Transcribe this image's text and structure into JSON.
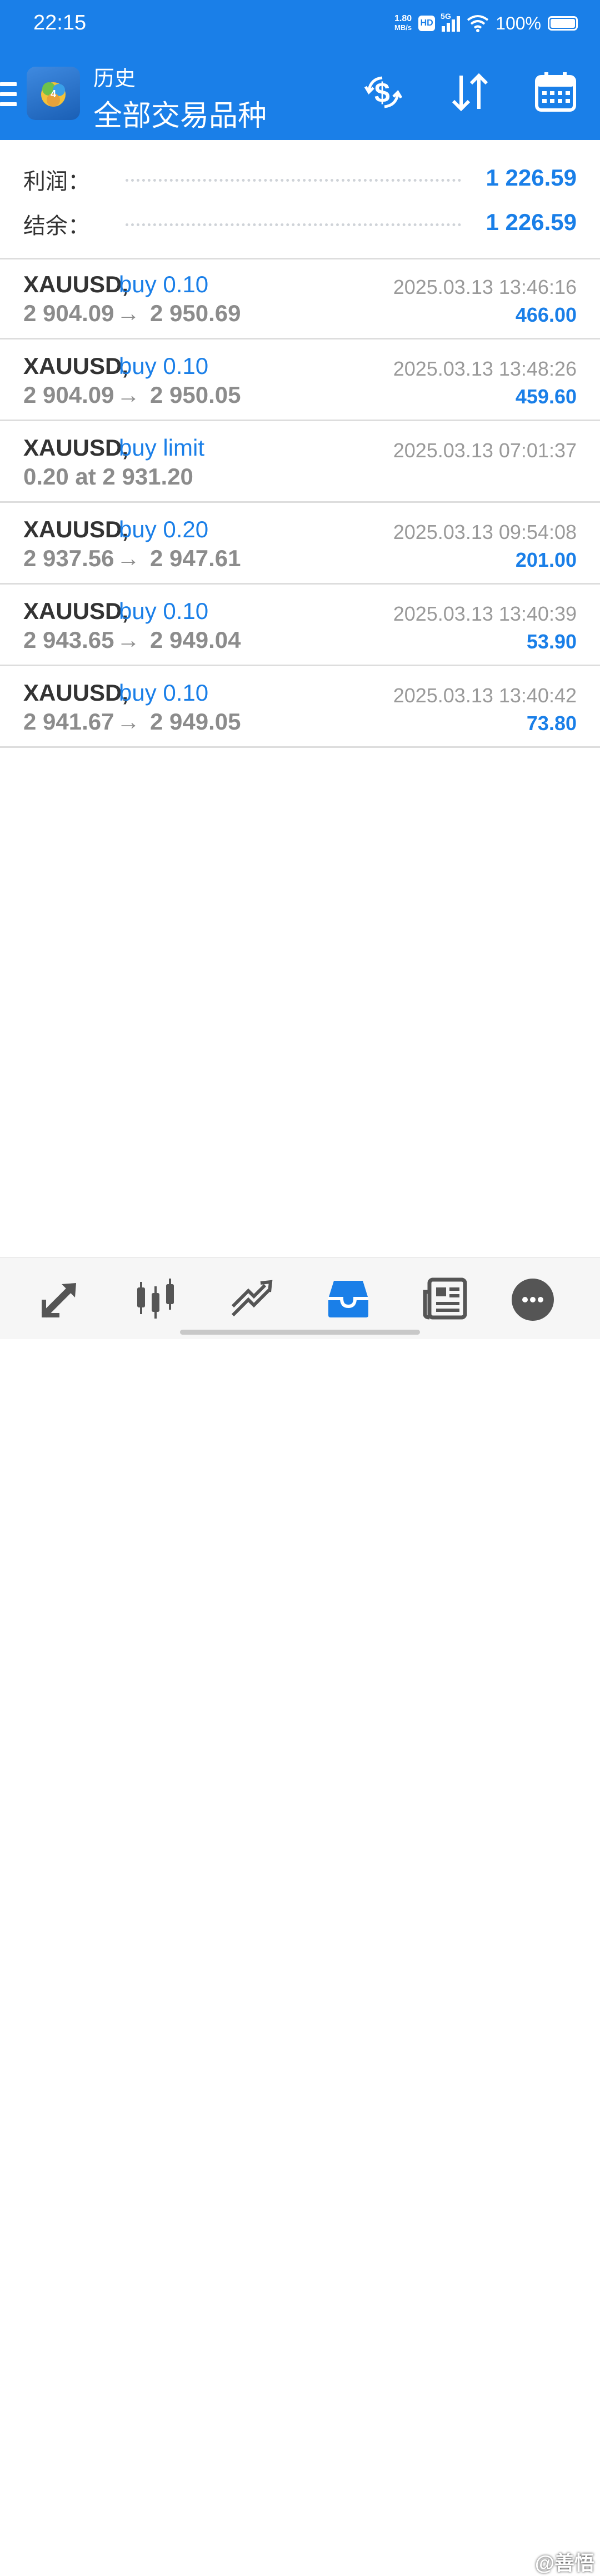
{
  "status_bar": {
    "time": "22:15",
    "net_speed_value": "1.80",
    "net_speed_unit": "MB/s",
    "hd_label": "HD",
    "network_type": "5G",
    "battery_percent": "100%"
  },
  "header": {
    "title": "历史",
    "subtitle": "全部交易品种",
    "icons": [
      "menu-icon",
      "app-logo",
      "currency-exchange-icon",
      "sort-icon",
      "calendar-icon"
    ]
  },
  "summary": {
    "profit_label": "利润：",
    "profit_value": "1 226.59",
    "balance_label": "结余：",
    "balance_value": "1 226.59"
  },
  "trades": [
    {
      "symbol": "XAUUSD,",
      "action": "buy 0.10",
      "open_price": "2 904.09",
      "arrow": "→",
      "close_price": "2 950.69",
      "time": "2025.03.13 13:46:16",
      "profit": "466.00"
    },
    {
      "symbol": "XAUUSD,",
      "action": "buy 0.10",
      "open_price": "2 904.09",
      "arrow": "→",
      "close_price": "2 950.05",
      "time": "2025.03.13 13:48:26",
      "profit": "459.60"
    },
    {
      "symbol": "XAUUSD,",
      "action": "buy limit",
      "open_price": "0.20 at 2 931.20",
      "arrow": "",
      "close_price": "",
      "time": "2025.03.13 07:01:37",
      "profit": ""
    },
    {
      "symbol": "XAUUSD,",
      "action": "buy 0.20",
      "open_price": "2 937.56",
      "arrow": "→",
      "close_price": "2 947.61",
      "time": "2025.03.13 09:54:08",
      "profit": "201.00"
    },
    {
      "symbol": "XAUUSD,",
      "action": "buy 0.10",
      "open_price": "2 943.65",
      "arrow": "→",
      "close_price": "2 949.04",
      "time": "2025.03.13 13:40:39",
      "profit": "53.90"
    },
    {
      "symbol": "XAUUSD,",
      "action": "buy 0.10",
      "open_price": "2 941.67",
      "arrow": "→",
      "close_price": "2 949.05",
      "time": "2025.03.13 13:40:42",
      "profit": "73.80"
    }
  ],
  "bottom_nav": {
    "items": [
      "quotes-icon",
      "chart-icon",
      "trade-icon",
      "history-icon",
      "news-icon",
      "messages-icon"
    ],
    "active": "history-icon"
  },
  "watermark": "@善悟",
  "colors": {
    "accent": "#1A7FE8",
    "text_dark": "#333333",
    "text_gray": "#8c8c8c",
    "divider": "#dddddd"
  }
}
